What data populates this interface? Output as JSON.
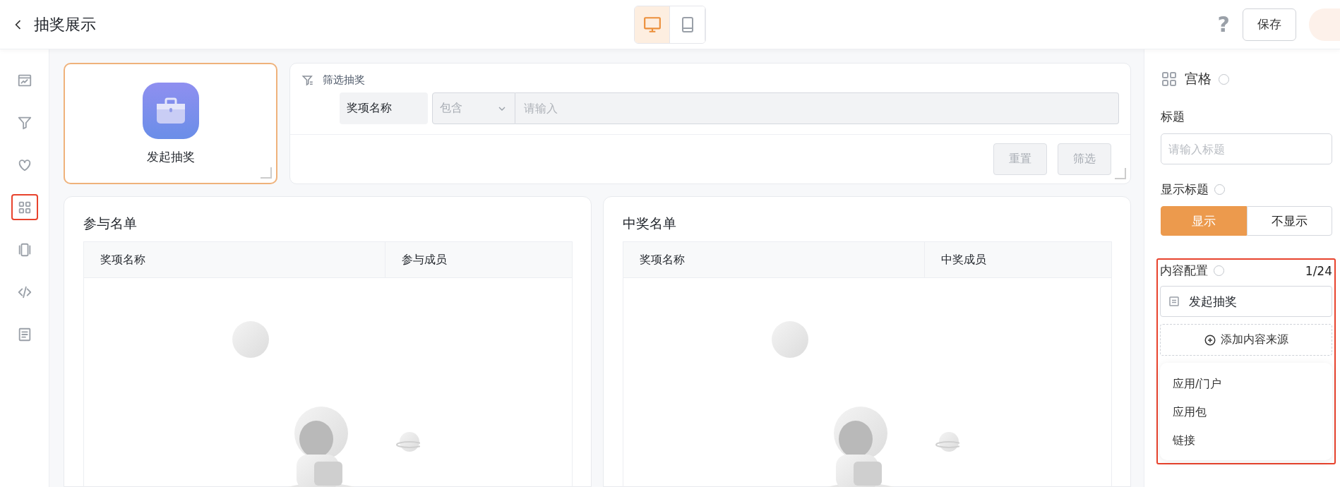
{
  "topbar": {
    "title": "抽奖展示",
    "devices": [
      {
        "kind": "desktop",
        "selected": true
      },
      {
        "kind": "tablet",
        "selected": false
      }
    ],
    "help": "?",
    "save": "保存"
  },
  "sidebar": {
    "items": [
      {
        "kind": "chart",
        "selected": false
      },
      {
        "kind": "filter",
        "selected": false
      },
      {
        "kind": "heart",
        "selected": false
      },
      {
        "kind": "grid",
        "selected": true
      },
      {
        "kind": "carousel",
        "selected": false
      },
      {
        "kind": "code",
        "selected": false
      },
      {
        "kind": "document",
        "selected": false
      }
    ]
  },
  "launch_card": {
    "label": "发起抽奖",
    "selected": true
  },
  "filter": {
    "title": "筛选抽奖",
    "field_label": "奖项名称",
    "operator": "包含",
    "placeholder": "请输入",
    "buttons": [
      "重置",
      "筛选"
    ]
  },
  "tables": [
    {
      "title": "参与名单",
      "columns": [
        "奖项名称",
        "参与成员"
      ]
    },
    {
      "title": "中奖名单",
      "columns": [
        "奖项名称",
        "中奖成员"
      ]
    }
  ],
  "panel": {
    "title": "宫格",
    "title_label": "标题",
    "title_placeholder": "请输入标题",
    "show_title_label": "显示标题",
    "show_options": [
      {
        "label": "显示",
        "selected": true
      },
      {
        "label": "不显示",
        "selected": false
      }
    ],
    "content_label": "内容配置",
    "count": "1/24",
    "highlighted": true,
    "items": [
      {
        "label": "发起抽奖"
      }
    ],
    "add_label": "添加内容来源",
    "menu": [
      "应用/门户",
      "应用包",
      "链接"
    ]
  }
}
